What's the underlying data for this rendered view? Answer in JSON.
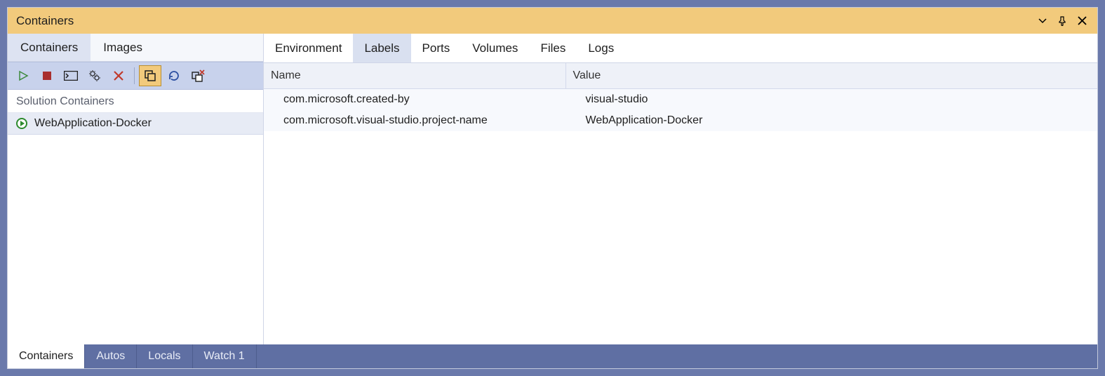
{
  "window": {
    "title": "Containers"
  },
  "left": {
    "tabs": [
      {
        "id": "containers",
        "label": "Containers",
        "active": true
      },
      {
        "id": "images",
        "label": "Images",
        "active": false
      }
    ],
    "toolbar": {
      "play": "play",
      "stop": "stop",
      "terminal": "terminal",
      "settings_restart": "settings-restart",
      "delete": "delete",
      "copy": "copy",
      "refresh": "refresh",
      "prune": "prune"
    },
    "group_header": "Solution Containers",
    "items": [
      {
        "name": "WebApplication-Docker",
        "status": "running"
      }
    ]
  },
  "detail": {
    "tabs": [
      {
        "id": "environment",
        "label": "Environment",
        "active": false
      },
      {
        "id": "labels",
        "label": "Labels",
        "active": true
      },
      {
        "id": "ports",
        "label": "Ports",
        "active": false
      },
      {
        "id": "volumes",
        "label": "Volumes",
        "active": false
      },
      {
        "id": "files",
        "label": "Files",
        "active": false
      },
      {
        "id": "logs",
        "label": "Logs",
        "active": false
      }
    ],
    "table": {
      "columns": {
        "name": "Name",
        "value": "Value"
      },
      "rows": [
        {
          "name": "com.microsoft.created-by",
          "value": "visual-studio"
        },
        {
          "name": "com.microsoft.visual-studio.project-name",
          "value": "WebApplication-Docker"
        }
      ]
    }
  },
  "bottom_tabs": [
    {
      "id": "containers",
      "label": "Containers",
      "active": true
    },
    {
      "id": "autos",
      "label": "Autos",
      "active": false
    },
    {
      "id": "locals",
      "label": "Locals",
      "active": false
    },
    {
      "id": "watch1",
      "label": "Watch 1",
      "active": false
    }
  ]
}
